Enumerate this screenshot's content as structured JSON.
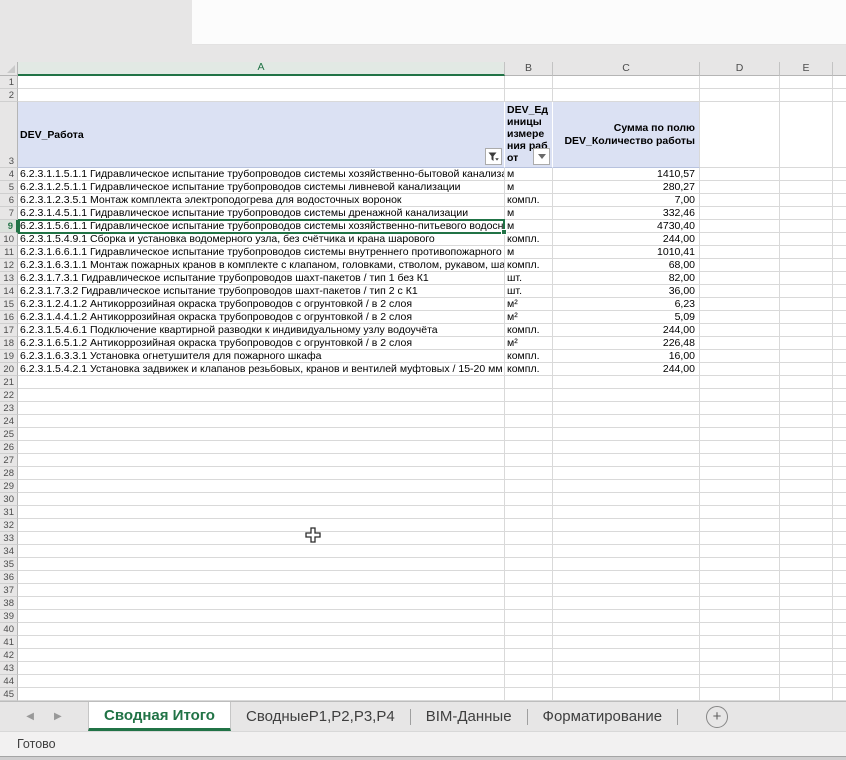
{
  "window": {
    "status": "Готово"
  },
  "colors": {
    "accent_green": "#217346",
    "pivot_header_fill": "#dbe1f3"
  },
  "icons": {
    "prev_sheet": "◀",
    "next_sheet": "▶"
  },
  "sheet": {
    "column_letters": [
      "A",
      "B",
      "C",
      "D",
      "E"
    ],
    "active_column": "A",
    "active_row": 9,
    "header_row_number": "3",
    "leading_empty_rows": [
      1,
      2
    ],
    "pivot": {
      "row_field_label": "DEV_Работа",
      "unit_field_label": "DEV_Единицы измерения работ",
      "values_label": "Сумма по полю DEV_Количество работы"
    },
    "rows": [
      {
        "n": 4,
        "work": "6.2.3.1.1.5.1.1 Гидравлическое испытание трубопроводов системы хозяйственно-бытовой канализации",
        "unit": "м",
        "qty": "1410,57"
      },
      {
        "n": 5,
        "work": "6.2.3.1.2.5.1.1 Гидравлическое испытание трубопроводов системы ливневой канализации",
        "unit": "м",
        "qty": "280,27"
      },
      {
        "n": 6,
        "work": "6.2.3.1.2.3.5.1 Монтаж комплекта электроподогрева для водосточных воронок",
        "unit": "компл.",
        "qty": "7,00"
      },
      {
        "n": 7,
        "work": "6.2.3.1.4.5.1.1 Гидравлическое испытание трубопроводов системы дренажной канализации",
        "unit": "м",
        "qty": "332,46"
      },
      {
        "n": 9,
        "work": "6.2.3.1.5.6.1.1 Гидравлическое испытание трубопроводов системы хозяйственно-питьевого водоснабжения",
        "unit": "м",
        "qty": "4730,40"
      },
      {
        "n": 10,
        "work": "6.2.3.1.5.4.9.1 Сборка и установка водомерного узла, без счётчика и крана шарового",
        "unit": "компл.",
        "qty": "244,00"
      },
      {
        "n": 11,
        "work": "6.2.3.1.6.6.1.1 Гидравлическое испытание трубопроводов системы внутреннего противопожарного водопровода и",
        "unit": "м",
        "qty": "1010,41"
      },
      {
        "n": 12,
        "work": "6.2.3.1.6.3.1.1 Монтаж пожарных кранов в комплекте с клапаном, головками, стволом, рукавом, шайбами, диафр",
        "unit": "компл.",
        "qty": "68,00"
      },
      {
        "n": 13,
        "work": "6.2.3.1.7.3.1 Гидравлическое испытание трубопроводов шахт-пакетов / тип 1 без К1",
        "unit": "шт.",
        "qty": "82,00"
      },
      {
        "n": 14,
        "work": "6.2.3.1.7.3.2 Гидравлическое испытание трубопроводов шахт-пакетов / тип 2 с К1",
        "unit": "шт.",
        "qty": "36,00"
      },
      {
        "n": 15,
        "work": "6.2.3.1.2.4.1.2 Антикоррозийная окраска трубопроводов с огрунтовкой / в 2 слоя",
        "unit": "м²",
        "qty": "6,23"
      },
      {
        "n": 16,
        "work": "6.2.3.1.4.4.1.2 Антикоррозийная окраска трубопроводов с огрунтовкой / в 2 слоя",
        "unit": "м²",
        "qty": "5,09"
      },
      {
        "n": 17,
        "work": "6.2.3.1.5.4.6.1 Подключение квартирной разводки к индивидуальному узлу водоучёта",
        "unit": "компл.",
        "qty": "244,00"
      },
      {
        "n": 18,
        "work": "6.2.3.1.6.5.1.2 Антикоррозийная окраска трубопроводов с огрунтовкой / в 2 слоя",
        "unit": "м²",
        "qty": "226,48"
      },
      {
        "n": 19,
        "work": "6.2.3.1.6.3.3.1 Установка огнетушителя для пожарного шкафа",
        "unit": "компл.",
        "qty": "16,00"
      },
      {
        "n": 20,
        "work": "6.2.3.1.5.4.2.1 Установка задвижек и клапанов резьбовых, кранов и вентилей муфтовых / 15-20 мм",
        "unit": "компл.",
        "qty": "244,00"
      }
    ],
    "empty_rows_start": 21,
    "empty_rows_end": 45
  },
  "tab_bar": {
    "tabs": [
      {
        "label": "Сводная Итого",
        "active": true
      },
      {
        "label": "СводныеР1,Р2,Р3,Р4",
        "active": false
      },
      {
        "label": "BIM-Данные",
        "active": false
      },
      {
        "label": "Форматирование",
        "active": false
      }
    ],
    "add_sheet_label": "+"
  }
}
